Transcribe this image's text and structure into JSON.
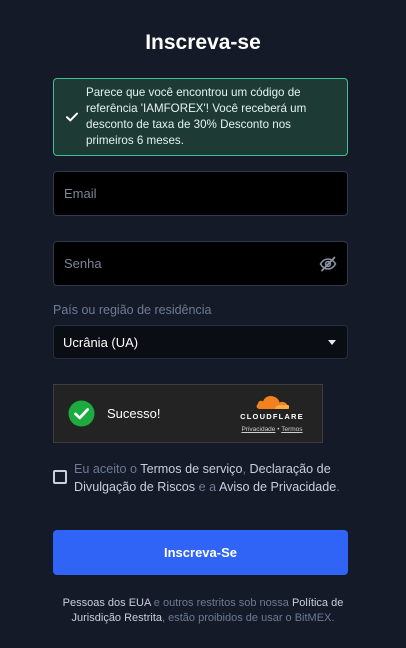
{
  "title": "Inscreva-se",
  "notice": {
    "text": "Parece que você encontrou um código de referência 'IAMFOREX'! Você receberá um desconto de taxa de 30% Desconto nos primeiros 6 meses.",
    "icon": "check-icon",
    "border_color": "#3fbf8f",
    "background": "#1d3a35"
  },
  "email": {
    "placeholder": "Email",
    "value": ""
  },
  "password": {
    "placeholder": "Senha",
    "value": "",
    "toggle_icon": "eye-off-icon"
  },
  "country": {
    "label": "País ou região de residência",
    "selected": "Ucrânia (UA)"
  },
  "captcha": {
    "status": "Sucesso!",
    "brand": "CLOUDFLARE",
    "privacy_link": "Privacidade",
    "separator": "•",
    "terms_link": "Termos",
    "success_color": "#1dab3f",
    "brand_color": "#f48120"
  },
  "terms": {
    "prefix": "Eu aceito o",
    "terms_of_service": "Termos de serviço",
    "comma": ",",
    "risk_disclosure": "Declaração de Divulgação de Riscos",
    "and": "e a",
    "privacy_notice": "Aviso de Privacidade",
    "period": "."
  },
  "submit_label": "Inscreva-Se",
  "footer": {
    "part1": "Pessoas dos EUA",
    "part2": "e outros restritos sob nossa",
    "policy_link": "Política de Jurisdição Restrita",
    "part3": ", estão proibidos de usar o BitMEX."
  },
  "colors": {
    "background": "#141a27",
    "primary_button": "#2f64f6",
    "muted_text": "#6e7b95"
  }
}
